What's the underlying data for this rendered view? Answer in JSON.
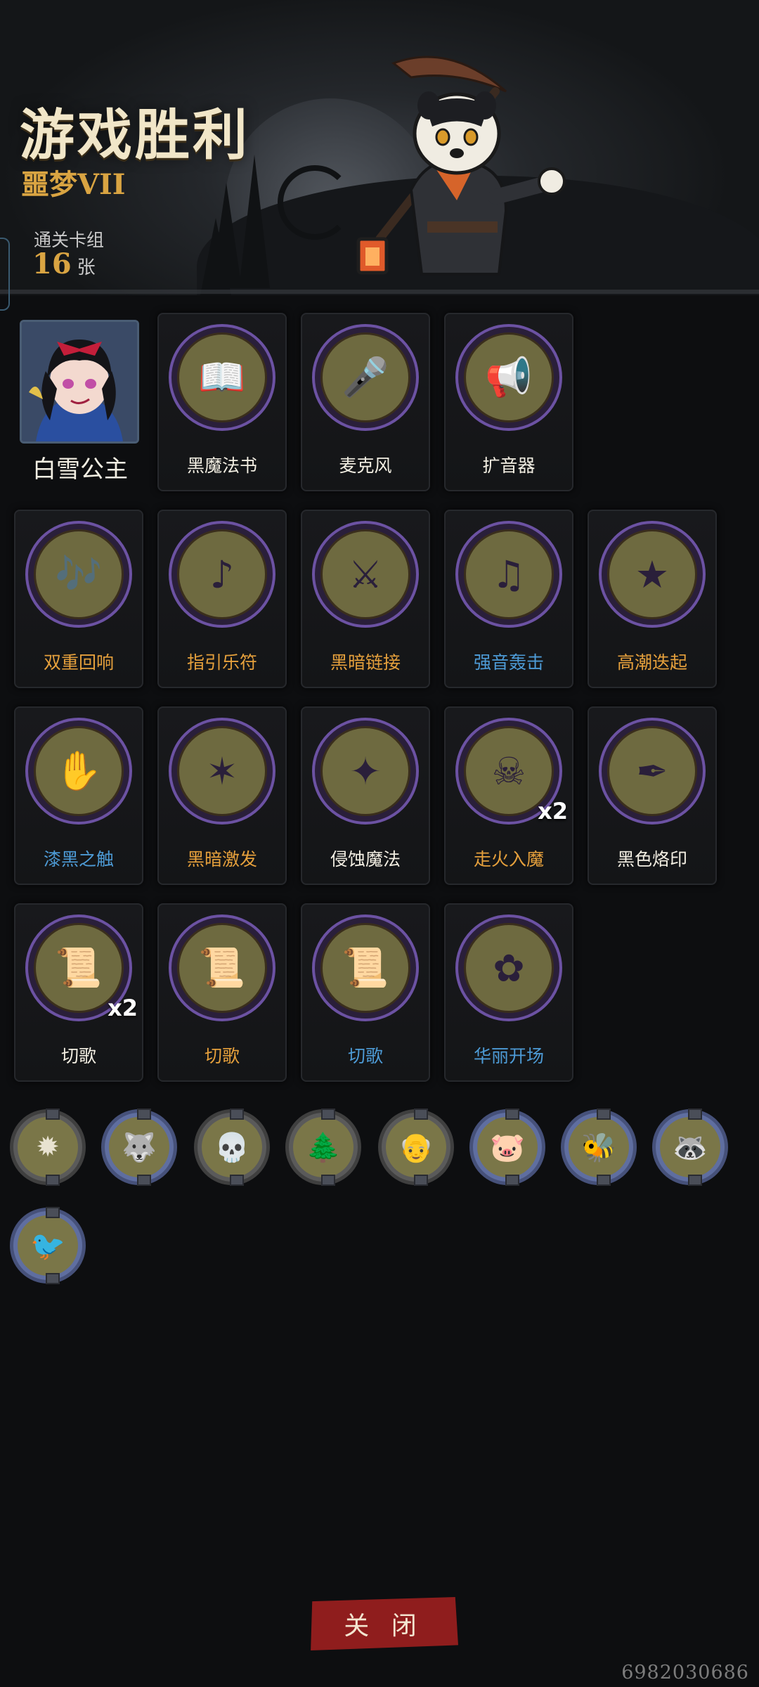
{
  "header": {
    "title": "游戏胜利",
    "difficulty": "噩梦VII",
    "deck_label": "通关卡组",
    "deck_count": "16",
    "deck_unit": "张"
  },
  "hero": {
    "name": "白雪公主"
  },
  "cards": [
    {
      "name": "黑魔法书",
      "color": "#f3efe3",
      "icon": "spellbook-icon",
      "qty": ""
    },
    {
      "name": "麦克风",
      "color": "#f3efe3",
      "icon": "microphone-icon",
      "qty": ""
    },
    {
      "name": "扩音器",
      "color": "#f3efe3",
      "icon": "megaphone-icon",
      "qty": ""
    },
    {
      "name": "双重回响",
      "color": "#e5a03c",
      "icon": "echo-icon",
      "qty": ""
    },
    {
      "name": "指引乐符",
      "color": "#e5a03c",
      "icon": "music-wave-icon",
      "qty": ""
    },
    {
      "name": "黑暗链接",
      "color": "#e5a03c",
      "icon": "dark-link-icon",
      "qty": ""
    },
    {
      "name": "强音轰击",
      "color": "#4d9bd6",
      "icon": "sound-blast-icon",
      "qty": ""
    },
    {
      "name": "高潮迭起",
      "color": "#e5a03c",
      "icon": "climax-icon",
      "qty": ""
    },
    {
      "name": "漆黑之触",
      "color": "#4d9bd6",
      "icon": "dark-touch-icon",
      "qty": ""
    },
    {
      "name": "黑暗激发",
      "color": "#e5a03c",
      "icon": "dark-burst-icon",
      "qty": ""
    },
    {
      "name": "侵蚀魔法",
      "color": "#f3efe3",
      "icon": "erosion-icon",
      "qty": ""
    },
    {
      "name": "走火入魔",
      "color": "#e5a03c",
      "icon": "possessed-icon",
      "qty": "x2"
    },
    {
      "name": "黑色烙印",
      "color": "#f3efe3",
      "icon": "dark-brand-icon",
      "qty": ""
    },
    {
      "name": "切歌",
      "color": "#f3efe3",
      "icon": "music-book-icon",
      "qty": "x2"
    },
    {
      "name": "切歌",
      "color": "#e5a03c",
      "icon": "music-book-icon",
      "qty": ""
    },
    {
      "name": "切歌",
      "color": "#4d9bd6",
      "icon": "music-book-icon",
      "qty": ""
    },
    {
      "name": "华丽开场",
      "color": "#4d9bd6",
      "icon": "grand-opening-icon",
      "qty": ""
    }
  ],
  "relics": [
    {
      "icon": "compass-relic-icon"
    },
    {
      "icon": "wolf-relic-icon"
    },
    {
      "icon": "skull-relic-icon"
    },
    {
      "icon": "forest-relic-icon"
    },
    {
      "icon": "monk-relic-icon"
    },
    {
      "icon": "pug-relic-icon"
    },
    {
      "icon": "bee-relic-icon"
    },
    {
      "icon": "raccoon-relic-icon"
    },
    {
      "icon": "crow-relic-icon"
    }
  ],
  "close_button": "关 闭",
  "uid": "6982030686",
  "colors": {
    "accent_gold": "#d9a442",
    "close_red": "#8f1d1d",
    "card_ring": "#6c52a3"
  }
}
